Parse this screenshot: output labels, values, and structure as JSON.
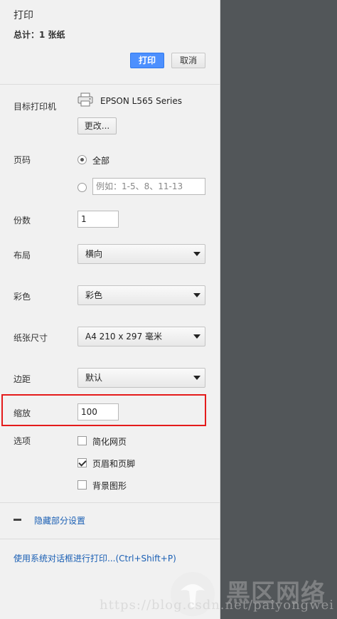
{
  "header": {
    "title": "打印",
    "total": "总计：1 张纸",
    "print_label": "打印",
    "cancel_label": "取消"
  },
  "destination": {
    "label": "目标打印机",
    "printer_name": "EPSON L565 Series",
    "change_label": "更改..."
  },
  "pages": {
    "label": "页码",
    "all_label": "全部",
    "all_selected": true,
    "custom_placeholder": "例如：1-5、8、11-13"
  },
  "copies": {
    "label": "份数",
    "value": "1"
  },
  "layout": {
    "label": "布局",
    "value": "横向"
  },
  "color": {
    "label": "彩色",
    "value": "彩色"
  },
  "paper_size": {
    "label": "纸张尺寸",
    "value": "A4 210 x 297 毫米"
  },
  "margins": {
    "label": "边距",
    "value": "默认"
  },
  "scale": {
    "label": "缩放",
    "value": "100"
  },
  "options": {
    "label": "选项",
    "items": [
      {
        "label": "简化网页",
        "checked": false
      },
      {
        "label": "页眉和页脚",
        "checked": true
      },
      {
        "label": "背景图形",
        "checked": false
      }
    ]
  },
  "footer": {
    "hide_settings_label": "隐藏部分设置",
    "system_dialog_link": "使用系统对话框进行打印...(Ctrl+Shift+P)"
  },
  "watermark": {
    "url_text": "https://blog.csdn.net/paiyongwei",
    "brand_text": "黑区网络"
  },
  "colors": {
    "primary_button": "#4d90fe",
    "highlight_box": "#e41b1b",
    "preview_bg": "#525659",
    "link": "#1a5fb4"
  }
}
